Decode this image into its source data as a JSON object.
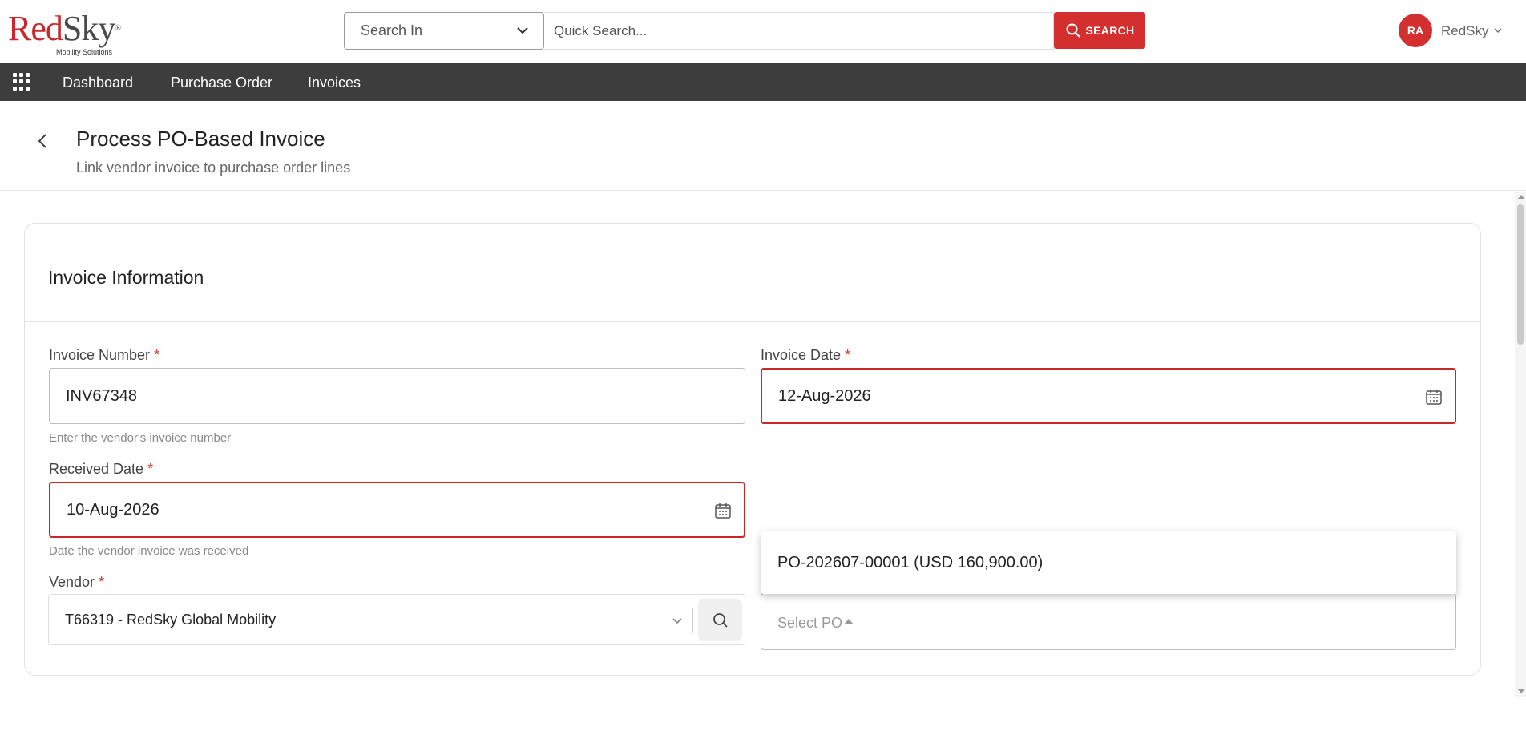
{
  "brand": {
    "logo_red": "Red",
    "logo_dark": "Sky",
    "logo_mark": "®",
    "tagline": "Mobility Solutions",
    "accent_color": "#d32f2f",
    "nav_bg": "#3d3d3d"
  },
  "search": {
    "scope_label": "Search In",
    "placeholder": "Quick Search...",
    "button_label": "SEARCH"
  },
  "user": {
    "initials": "RA",
    "name": "RedSky"
  },
  "nav": {
    "items": [
      {
        "label": "Dashboard"
      },
      {
        "label": "Purchase Order"
      },
      {
        "label": "Invoices"
      }
    ]
  },
  "page": {
    "title": "Process PO-Based Invoice",
    "subtitle": "Link vendor invoice to purchase order lines"
  },
  "card": {
    "title": "Invoice Information"
  },
  "form": {
    "required_mark": "*",
    "invoice_number": {
      "label": "Invoice Number",
      "value": "INV67348",
      "helper": "Enter the vendor's invoice number"
    },
    "invoice_date": {
      "label": "Invoice Date",
      "value": "12-Aug-2026"
    },
    "received_date": {
      "label": "Received Date",
      "value": "10-Aug-2026",
      "helper": "Date the vendor invoice was received"
    },
    "vendor": {
      "label": "Vendor",
      "value": "T66319 -  RedSky Global Mobility"
    },
    "po": {
      "placeholder": "Select PO",
      "options": [
        {
          "label": "PO-202607-00001 (USD 160,900.00)"
        }
      ]
    }
  }
}
